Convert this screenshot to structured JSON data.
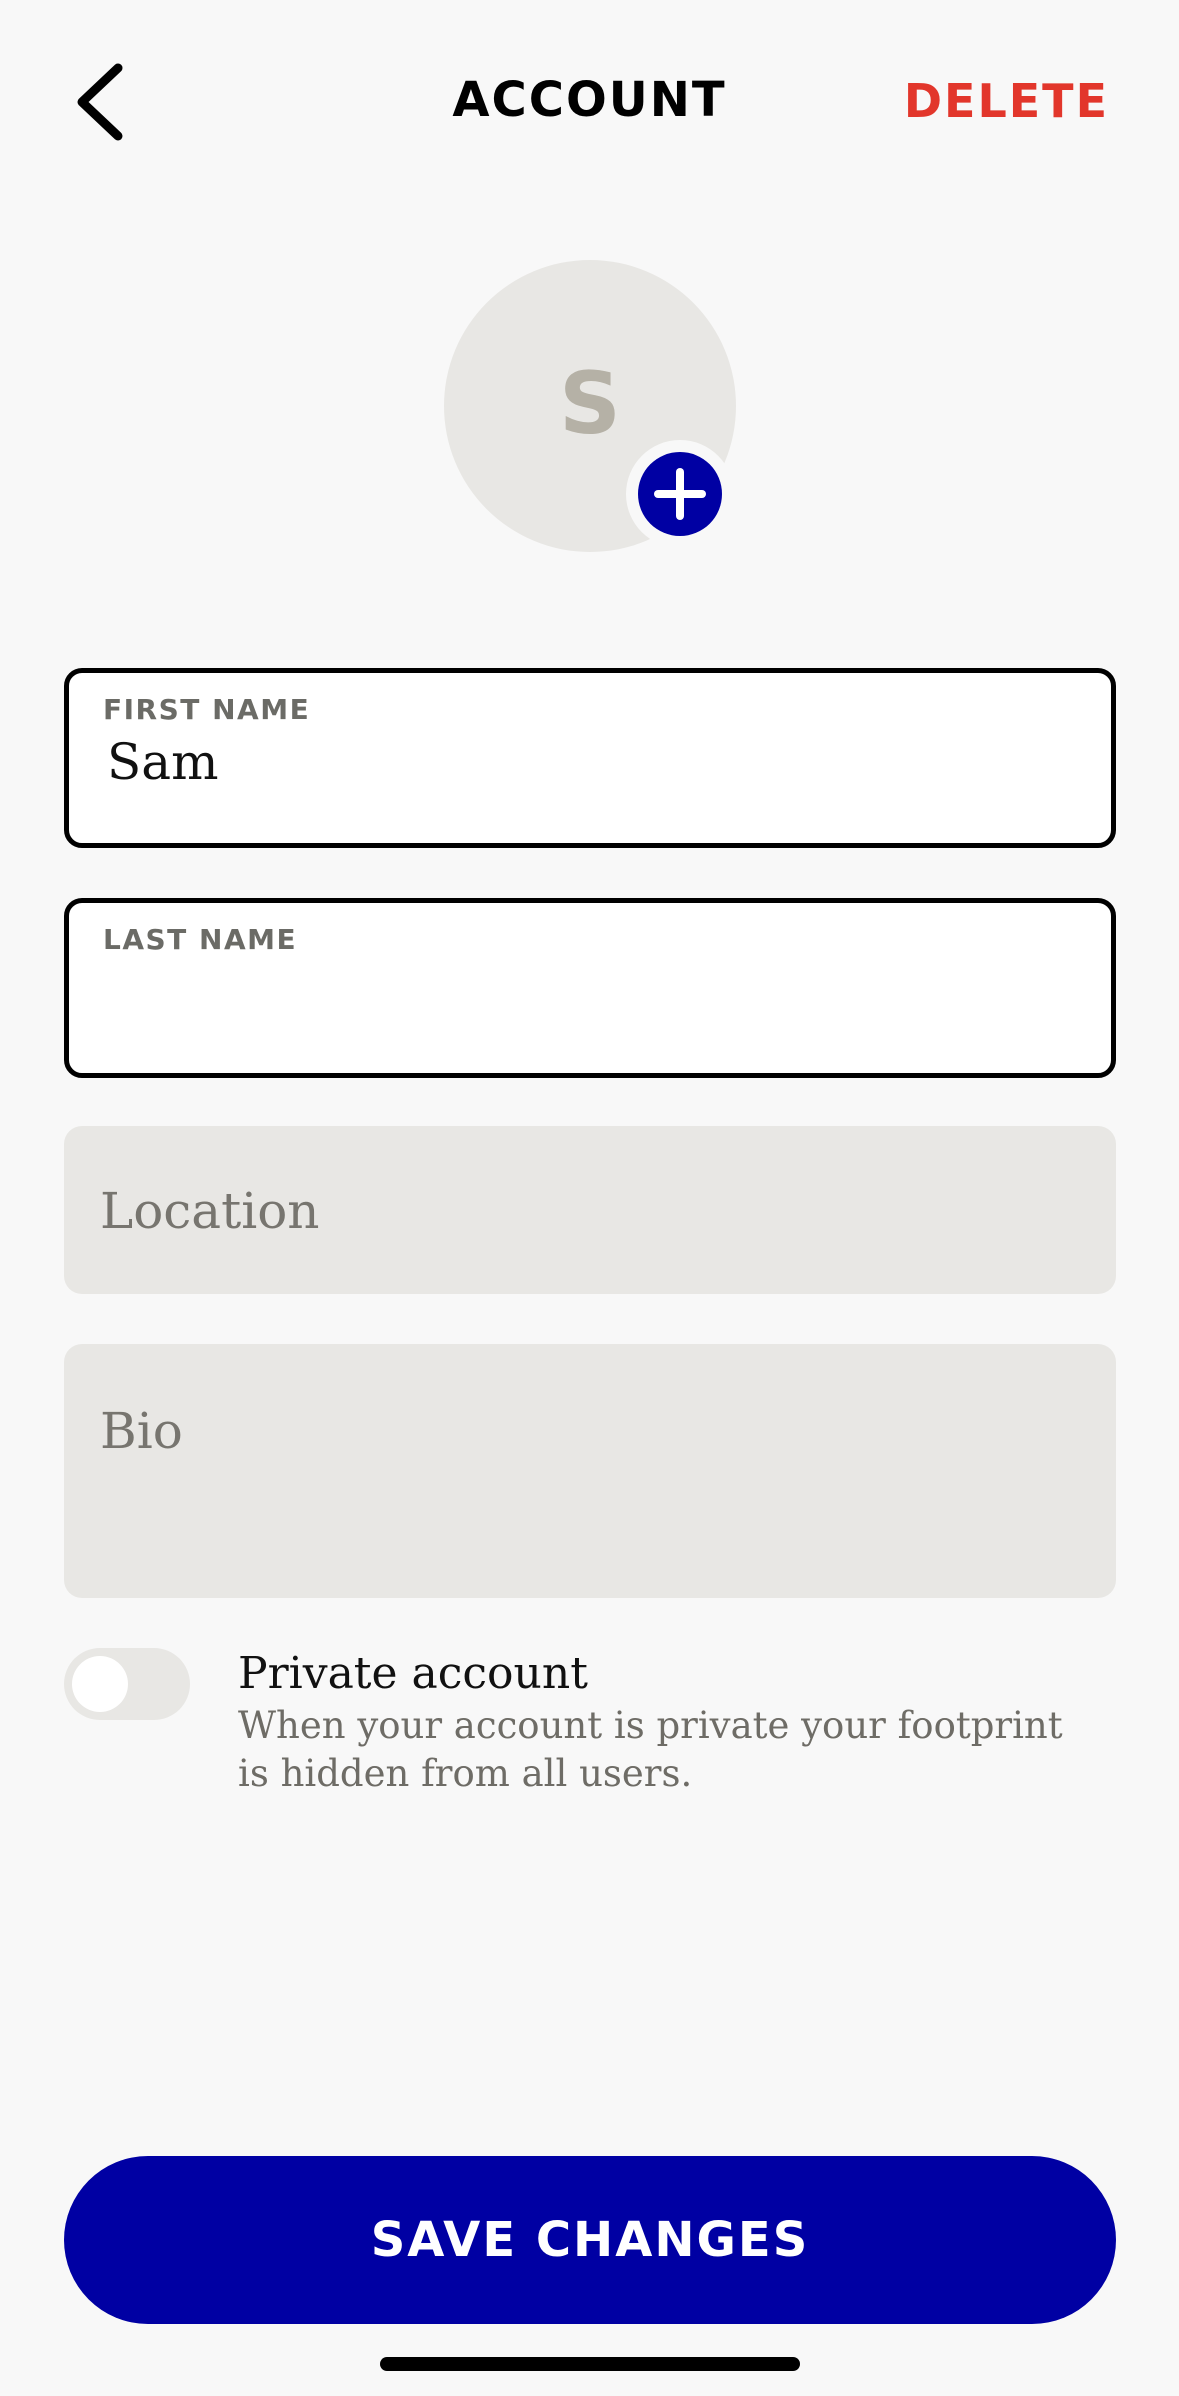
{
  "header": {
    "title": "ACCOUNT",
    "delete_label": "DELETE",
    "back_icon": "chevron-left-icon"
  },
  "avatar": {
    "initial": "S",
    "add_icon": "plus-icon"
  },
  "form": {
    "first_name": {
      "label": "FIRST NAME",
      "value": "Sam"
    },
    "last_name": {
      "label": "LAST NAME",
      "value": ""
    },
    "location": {
      "placeholder": "Location",
      "value": ""
    },
    "bio": {
      "placeholder": "Bio",
      "value": ""
    }
  },
  "privacy": {
    "toggle_on": false,
    "title": "Private account",
    "description": "When your account is private your footprint is hidden from all users."
  },
  "actions": {
    "save_label": "SAVE CHANGES"
  },
  "colors": {
    "accent": "#0000a3",
    "danger": "#e2362b",
    "background": "#f8f8f8",
    "field_fill": "#e8e7e4"
  }
}
